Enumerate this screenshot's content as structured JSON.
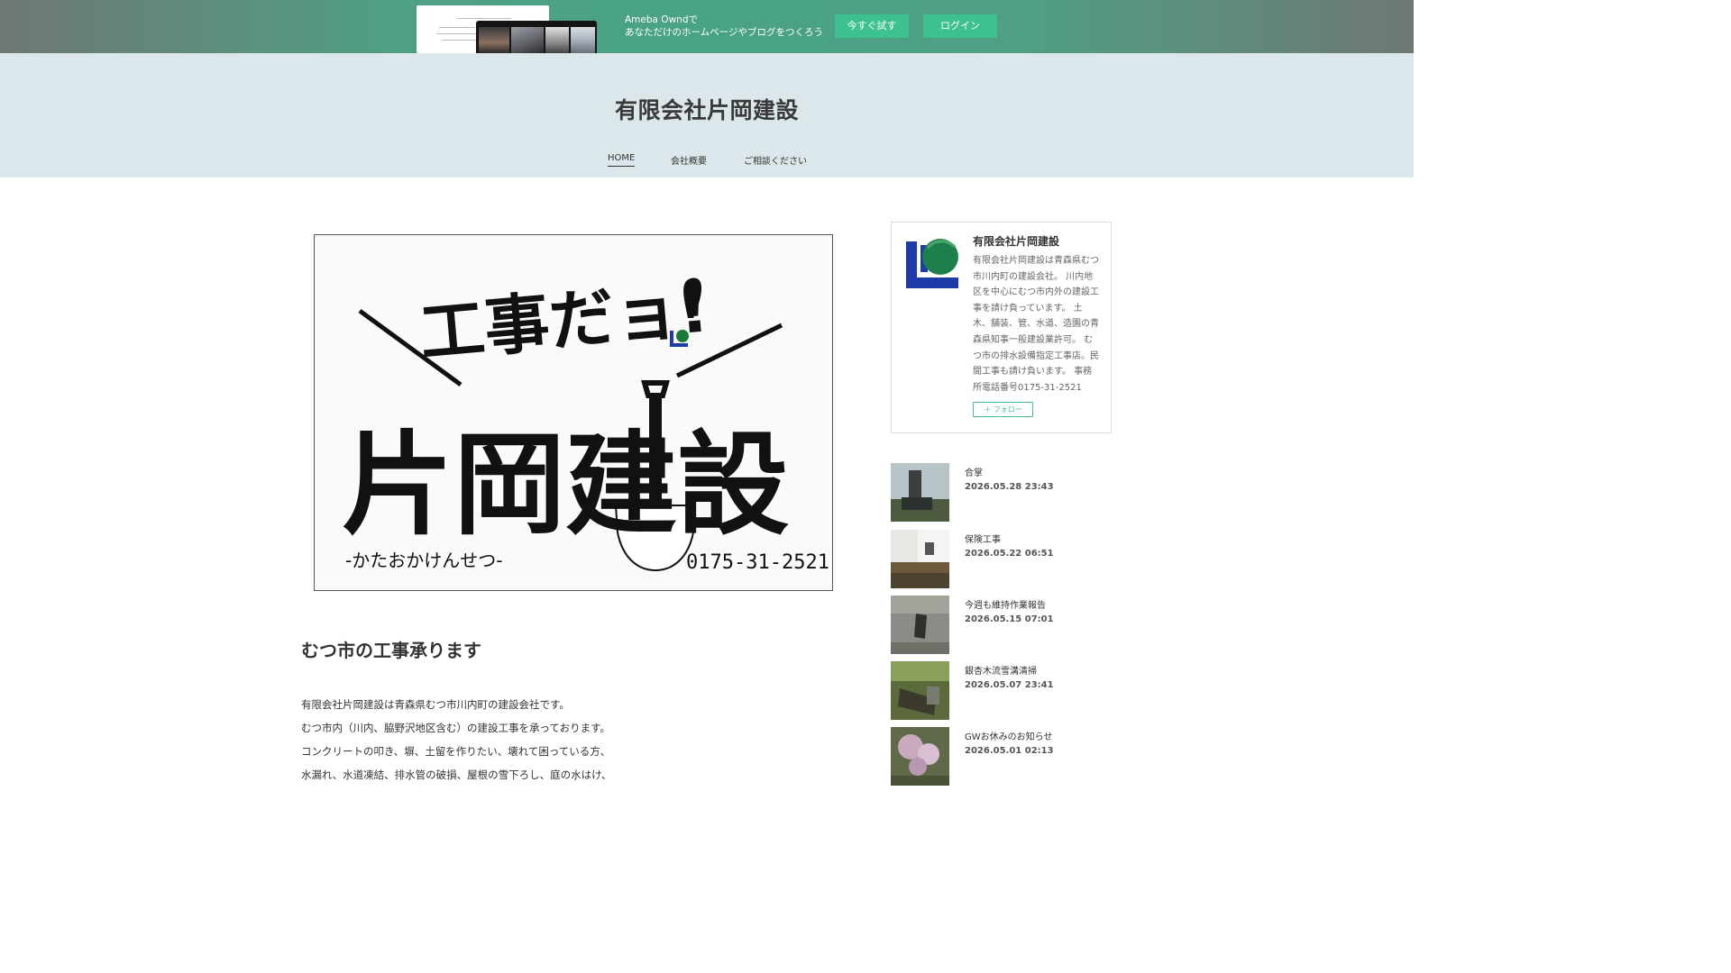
{
  "promo": {
    "line1": "Ameba Owndで",
    "line2": "あなただけのホームページやブログをつくろう",
    "try_label": "今すぐ試す",
    "login_label": "ログイン",
    "accent": "#3dc18e"
  },
  "header": {
    "site_title": "有限会社片岡建設",
    "nav": [
      "HOME",
      "会社概要",
      "ご相談ください"
    ],
    "background": "#dbe7ea"
  },
  "hero": {
    "line1": "工事だョ!",
    "line2": "片岡建設",
    "reading": "-かたおかけんせつ-",
    "phone": "0175-31-2521"
  },
  "article": {
    "title": "むつ市の工事承ります",
    "paragraphs": [
      "有限会社片岡建設は青森県むつ市川内町の建設会社です。",
      "むつ市内（川内、脇野沢地区含む）の建設工事を承っております。",
      "コンクリートの叩き、塀、土留を作りたい、壊れて困っている方、",
      "水漏れ、水道凍結、排水管の破損、屋根の雪下ろし、庭の水はけ、"
    ]
  },
  "profile": {
    "name": "有限会社片岡建設",
    "description": "有限会社片岡建設は青森県むつ市川内町の建設会社。 川内地区を中心にむつ市内外の建設工事を請け負っています。 土木、舗装、管、水道、造園の青森県知事一般建設業許可。 むつ市の排水設備指定工事店。民間工事も請け負います。 事務所電話番号0175-31-2521",
    "follow_label": "フォロー"
  },
  "posts": [
    {
      "title": "合掌",
      "date": "2026.05.28 23:43"
    },
    {
      "title": "保険工事",
      "date": "2026.05.22 06:51"
    },
    {
      "title": "今週も維持作業報告",
      "date": "2026.05.15 07:01"
    },
    {
      "title": "銀杏木流雪溝清掃",
      "date": "2026.05.07 23:41"
    },
    {
      "title": "GWお休みのお知らせ",
      "date": "2026.05.01 02:13"
    }
  ]
}
